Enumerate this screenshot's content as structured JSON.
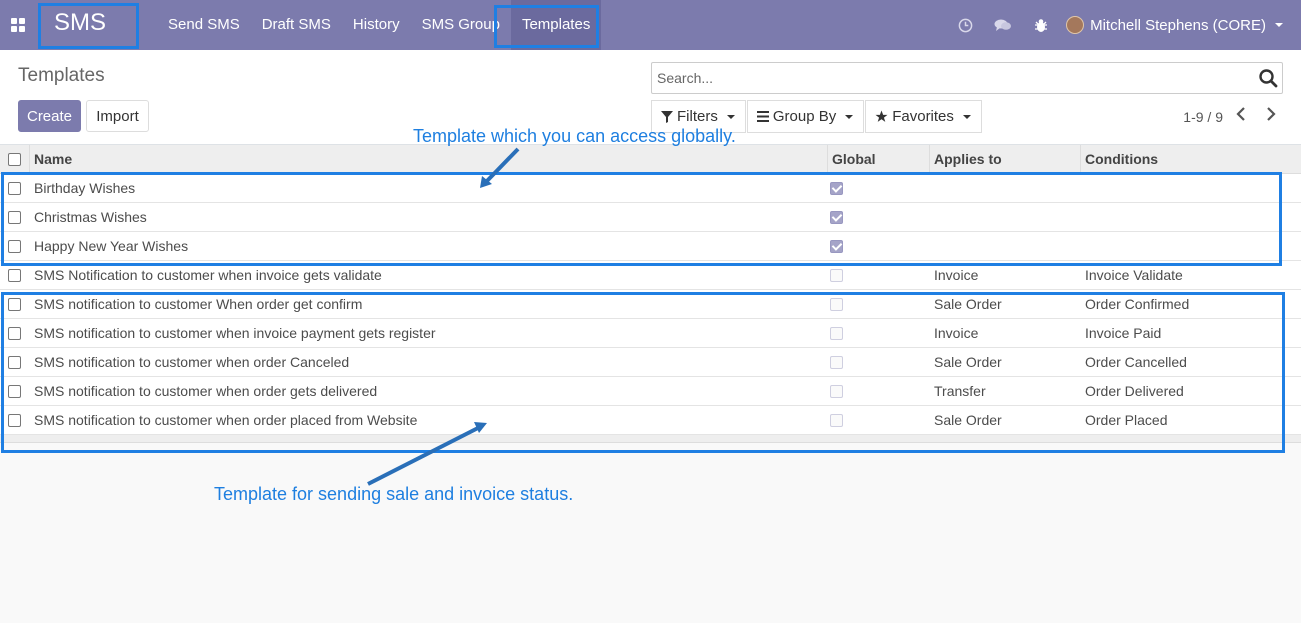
{
  "navbar": {
    "brand": "SMS",
    "menu": [
      "Send SMS",
      "Draft SMS",
      "History",
      "SMS Group",
      "Templates"
    ],
    "active_menu": "Templates",
    "user": "Mitchell Stephens (CORE)"
  },
  "control": {
    "title": "Templates",
    "create_label": "Create",
    "import_label": "Import",
    "search_placeholder": "Search...",
    "filters_label": "Filters",
    "groupby_label": "Group By",
    "favorites_label": "Favorites",
    "pager": "1-9 / 9"
  },
  "table": {
    "headers": {
      "name": "Name",
      "global": "Global",
      "applies": "Applies to",
      "conditions": "Conditions"
    },
    "rows": [
      {
        "name": "Birthday Wishes",
        "global": true,
        "applies": "",
        "conditions": ""
      },
      {
        "name": "Christmas Wishes",
        "global": true,
        "applies": "",
        "conditions": ""
      },
      {
        "name": "Happy New Year Wishes",
        "global": true,
        "applies": "",
        "conditions": ""
      },
      {
        "name": "SMS Notification to customer when invoice gets validate",
        "global": false,
        "applies": "Invoice",
        "conditions": "Invoice Validate"
      },
      {
        "name": "SMS notification to customer When order get confirm",
        "global": false,
        "applies": "Sale Order",
        "conditions": "Order Confirmed"
      },
      {
        "name": "SMS notification to customer when invoice payment gets register",
        "global": false,
        "applies": "Invoice",
        "conditions": "Invoice Paid"
      },
      {
        "name": "SMS notification to customer when order Canceled",
        "global": false,
        "applies": "Sale Order",
        "conditions": "Order Cancelled"
      },
      {
        "name": "SMS notification to customer when order gets delivered",
        "global": false,
        "applies": "Transfer",
        "conditions": "Order Delivered"
      },
      {
        "name": "SMS notification to customer when order placed from Website",
        "global": false,
        "applies": "Sale Order",
        "conditions": "Order Placed"
      }
    ]
  },
  "annotations": {
    "global_note": "Template which you can access globally.",
    "status_note": "Template for sending sale and invoice status."
  },
  "colors": {
    "navbar": "#7c7bad",
    "annotation": "#1f7fe3"
  }
}
